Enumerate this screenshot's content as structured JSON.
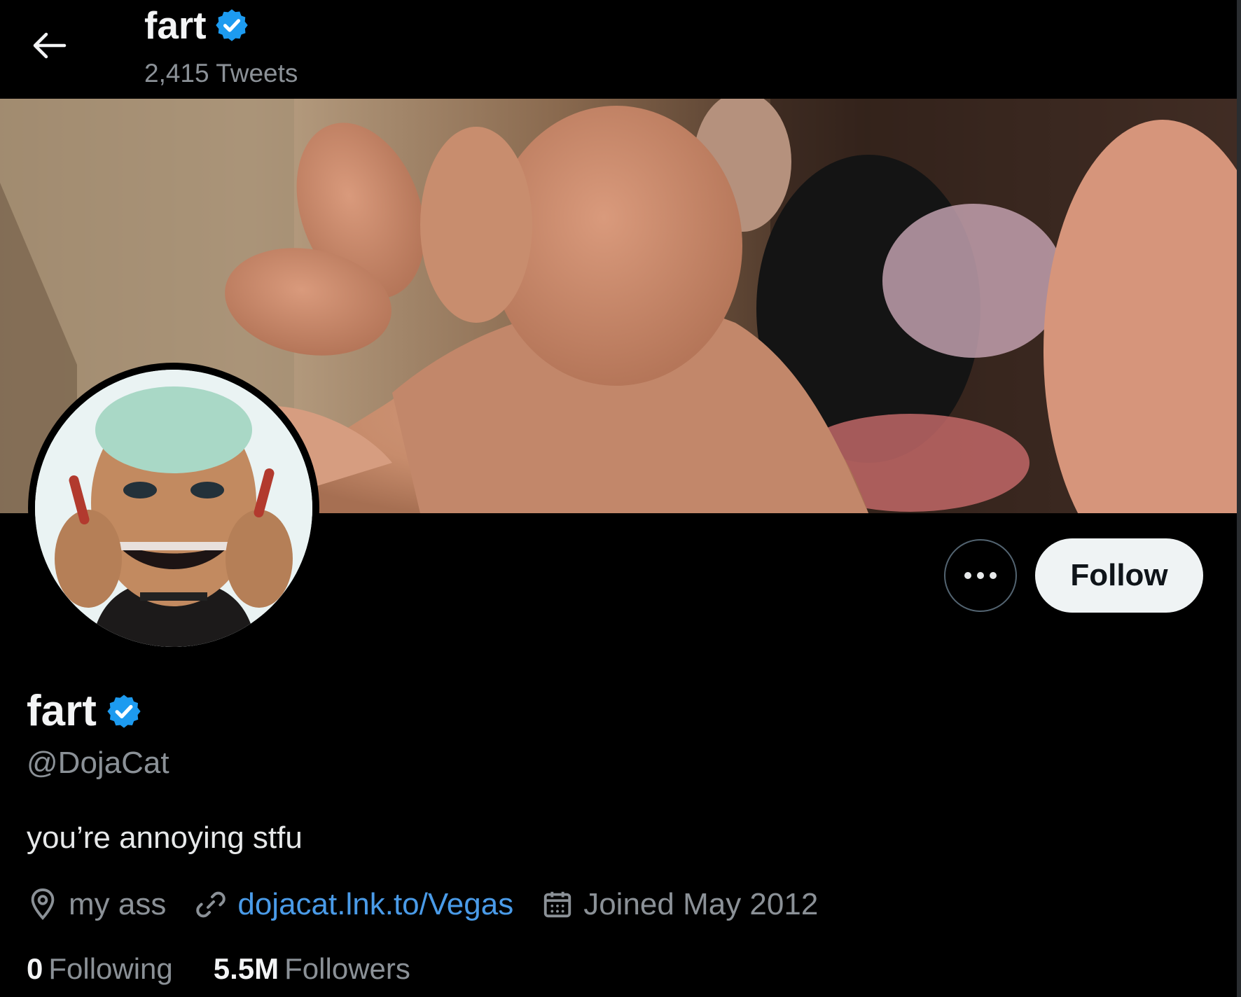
{
  "header": {
    "display_name": "fart",
    "tweet_count": "2,415 Tweets"
  },
  "profile": {
    "display_name": "fart",
    "handle": "@DojaCat",
    "bio": "you’re annoying stfu",
    "location": "my ass",
    "website": "dojacat.lnk.to/Vegas",
    "joined": "Joined May 2012"
  },
  "actions": {
    "follow_label": "Follow"
  },
  "stats": {
    "following_count": "0",
    "following_label": "Following",
    "followers_count": "5.5M",
    "followers_label": "Followers"
  },
  "colors": {
    "background": "#000000",
    "verified_badge": "#1d9bf0",
    "link": "#4a9be8",
    "muted_text": "#8b9197",
    "follow_button_bg": "#eff3f4"
  },
  "icons": [
    "back-arrow-icon",
    "verified-badge-icon",
    "more-icon",
    "location-icon",
    "link-icon",
    "calendar-icon"
  ]
}
